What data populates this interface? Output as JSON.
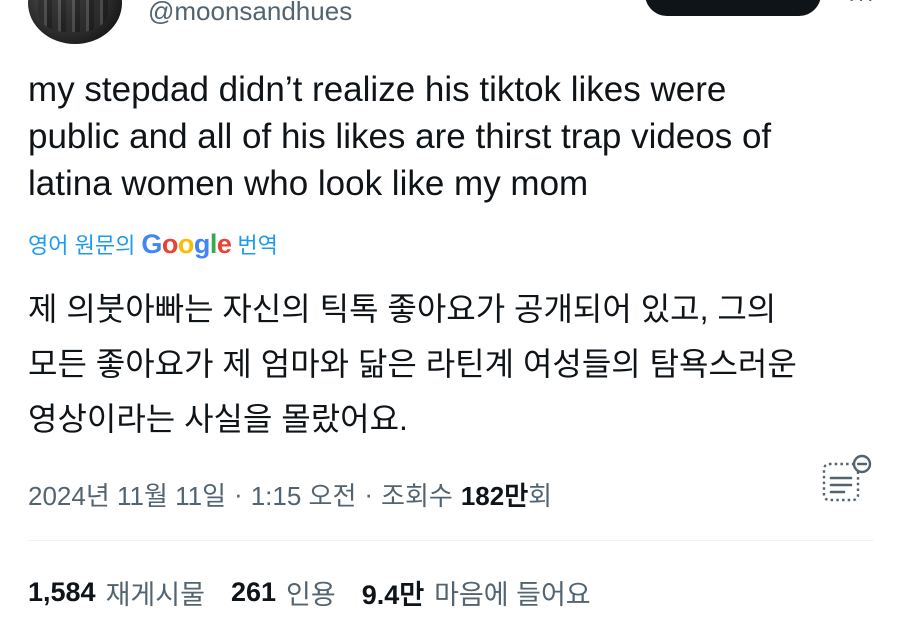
{
  "author": {
    "handle": "@moonsandhues"
  },
  "tweet": {
    "text": "my stepdad didn’t realize his tiktok likes were\npublic and all of his likes are thirst trap videos of\nlatina women who look like my mom"
  },
  "translation": {
    "prefix": "영어 원문의",
    "google_letters": [
      "G",
      "o",
      "o",
      "g",
      "l",
      "e"
    ],
    "suffix": "번역",
    "text": "제 의붓아빠는 자신의 틱톡 좋아요가 공개되어 있고, 그의\n모든 좋아요가 제 엄마와 닮은 라틴계 여성들의 탐욕스러운\n영상이라는 사실을 몰랐어요."
  },
  "meta": {
    "date": "2024년 11월 11일",
    "sep1": "·",
    "time": "1:15 오전",
    "sep2": "·",
    "views_label": "조회수",
    "views_count": "182만",
    "views_suffix": "회"
  },
  "stats": {
    "reposts_count": "1,584",
    "reposts_label": "재게시물",
    "quotes_count": "261",
    "quotes_label": "인용",
    "likes_count": "9.4만",
    "likes_label": "마음에 들어요"
  },
  "icons": {
    "analytics": "post-analytics-icon",
    "more": "more-icon"
  },
  "colors": {
    "link": "#1d9bf0",
    "secondary_text": "#536471",
    "primary_text": "#0f1419"
  }
}
